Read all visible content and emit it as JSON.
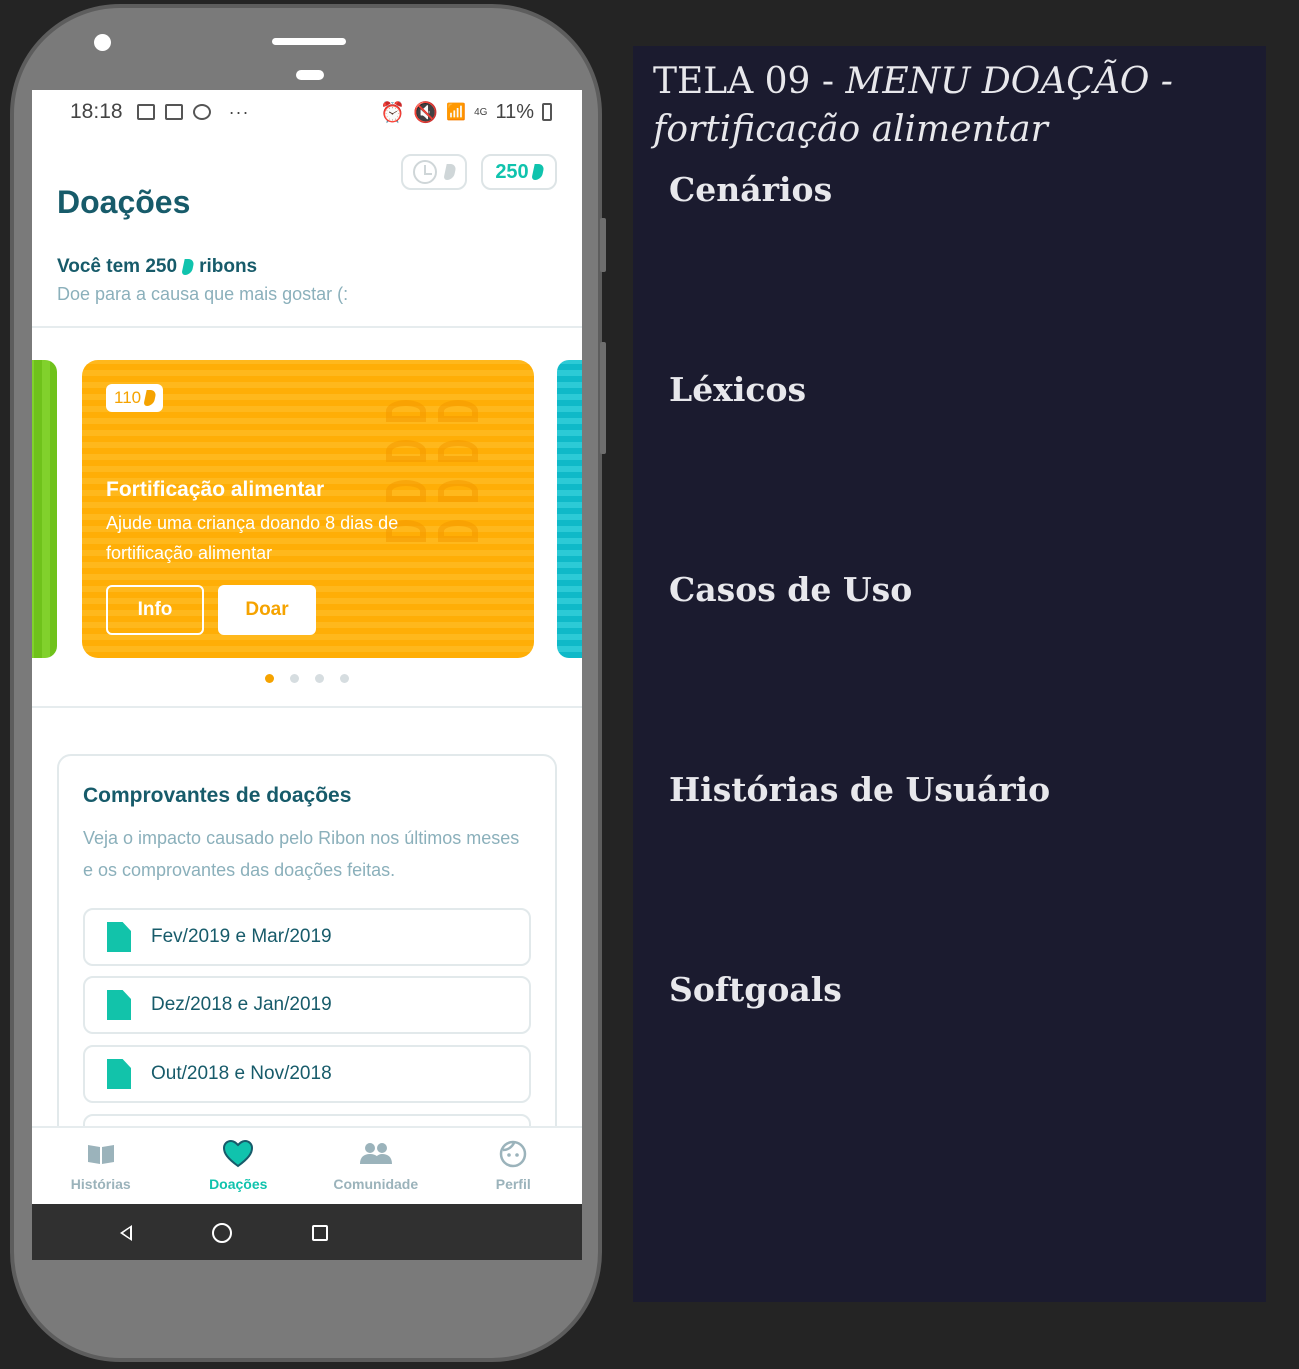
{
  "status_bar": {
    "time": "18:18",
    "more": "···",
    "network": "4G",
    "battery": "11%"
  },
  "header": {
    "title": "Doações",
    "balance_badge": "250",
    "balance_prefix": "Você tem 250",
    "balance_suffix": "ribons",
    "subtitle": "Doe para a causa que mais gostar (:"
  },
  "carousel": {
    "card": {
      "cost": "110",
      "title": "Fortificação alimentar",
      "description": "Ajude uma criança doando 8 dias de fortificação alimentar",
      "info_label": "Info",
      "donate_label": "Doar",
      "color": "#ffb000"
    },
    "active_page": 1,
    "page_count": 4
  },
  "receipts": {
    "title": "Comprovantes de doações",
    "description": "Veja o impacto causado pelo Ribon nos últimos meses e os comprovantes das doações feitas.",
    "items": [
      {
        "label": "Fev/2019 e Mar/2019"
      },
      {
        "label": "Dez/2018 e Jan/2019"
      },
      {
        "label": "Out/2018 e Nov/2018"
      }
    ]
  },
  "bottom_nav": {
    "items": [
      {
        "label": "Histórias",
        "icon": "book-icon"
      },
      {
        "label": "Doações",
        "icon": "heart-icon",
        "active": true
      },
      {
        "label": "Comunidade",
        "icon": "people-icon"
      },
      {
        "label": "Perfil",
        "icon": "face-icon"
      }
    ]
  },
  "panel": {
    "title_prefix": "TELA 09 - ",
    "title_italic": "MENU DOAÇÃO - fortificação alimentar",
    "sections": [
      "Cenários",
      "Léxicos",
      "Casos de Uso",
      "Histórias de Usuário",
      "Softgoals"
    ]
  },
  "colors": {
    "accent": "#10c3ad",
    "primary_text": "#175b6a",
    "card": "#ffb000",
    "panel_bg": "#1b1b2f"
  }
}
